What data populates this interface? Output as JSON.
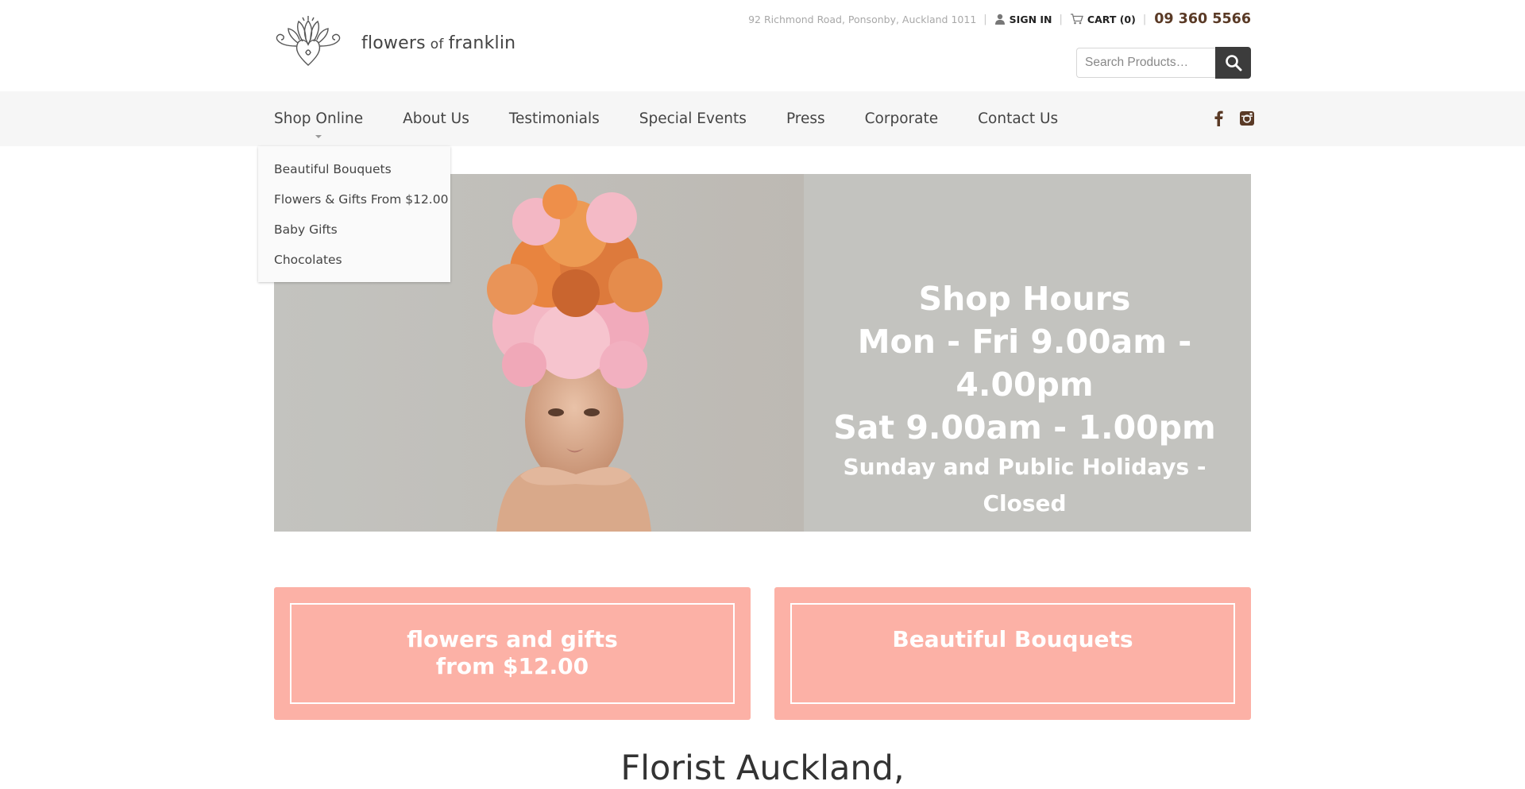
{
  "brand": {
    "name_part1": "flowers",
    "name_of": "of",
    "name_part2": "franklin"
  },
  "topbar": {
    "address": "92 Richmond Road, Ponsonby, Auckland 1011",
    "sign_in": "SIGN IN",
    "cart": "CART (0)",
    "phone": "09 360 5566"
  },
  "search": {
    "placeholder": "Search Products…",
    "icon": "search-icon"
  },
  "nav": {
    "items": [
      "Shop Online",
      "About Us",
      "Testimonials",
      "Special Events",
      "Press",
      "Corporate",
      "Contact Us"
    ],
    "social_icons": [
      "facebook-icon",
      "instagram-icon"
    ]
  },
  "dropdown": {
    "items": [
      "Beautiful Bouquets",
      "Flowers & Gifts From $12.00",
      "Baby Gifts",
      "Chocolates"
    ]
  },
  "hero": {
    "line1": "Shop Hours",
    "line2": "Mon - Fri 9.00am - 4.00pm",
    "line3": "Sat 9.00am - 1.00pm",
    "line4": "Sunday and Public Holidays - Closed"
  },
  "promos": [
    {
      "label": "flowers and gifts\nfrom $12.00"
    },
    {
      "label": "Beautiful Bouquets"
    }
  ],
  "heading": "Florist Auckland,",
  "colors": {
    "promo_bg": "#fcb1a6",
    "phone": "#5a3a26",
    "hero_bg": "#c3c3bf",
    "search_button": "#3c3c3c"
  }
}
